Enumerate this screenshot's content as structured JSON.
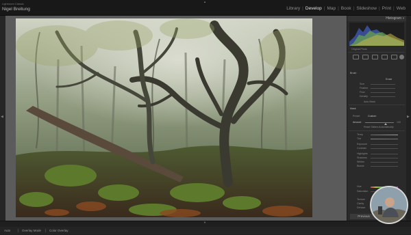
{
  "app": {
    "brand_subtitle": "Lightroom Classic",
    "user_name": "Nigel Breitung"
  },
  "modules": [
    "Library",
    "Develop",
    "Map",
    "Book",
    "Slideshow",
    "Print",
    "Web"
  ],
  "active_module": "Develop",
  "right_panel": {
    "histogram_title": "Histogram",
    "original_photo_label": "Original Photo",
    "brush_label": "Brush",
    "brush_mode": "Erase",
    "brush_fields": [
      "Size",
      "Feather",
      "Flow",
      "Density"
    ],
    "auto_mask_label": "Auto Mask",
    "mask_label": "Mask",
    "preset_label": "Preset",
    "preset_value": "Custom",
    "amount_label": "Amount",
    "amount_value": "100",
    "auto_mask_checkbox_label": "Reset Sliders Automatically",
    "tone_fields": [
      "Temp",
      "Tint",
      "Exposure",
      "Contrast",
      "Highlights",
      "Shadows",
      "Whites",
      "Blacks"
    ],
    "color_fields": [
      "Hue",
      "Saturation"
    ],
    "effects_fields": [
      "Texture",
      "Clarity",
      "Dehaze"
    ],
    "previous_button": "Previous",
    "reset_button": "Reset"
  },
  "bottom": {
    "items": [
      "Auto",
      "Overlay Mode",
      "Color Overlay"
    ]
  },
  "colors": {
    "accent": "#e8e8e8",
    "panel": "#2a2a2a"
  }
}
